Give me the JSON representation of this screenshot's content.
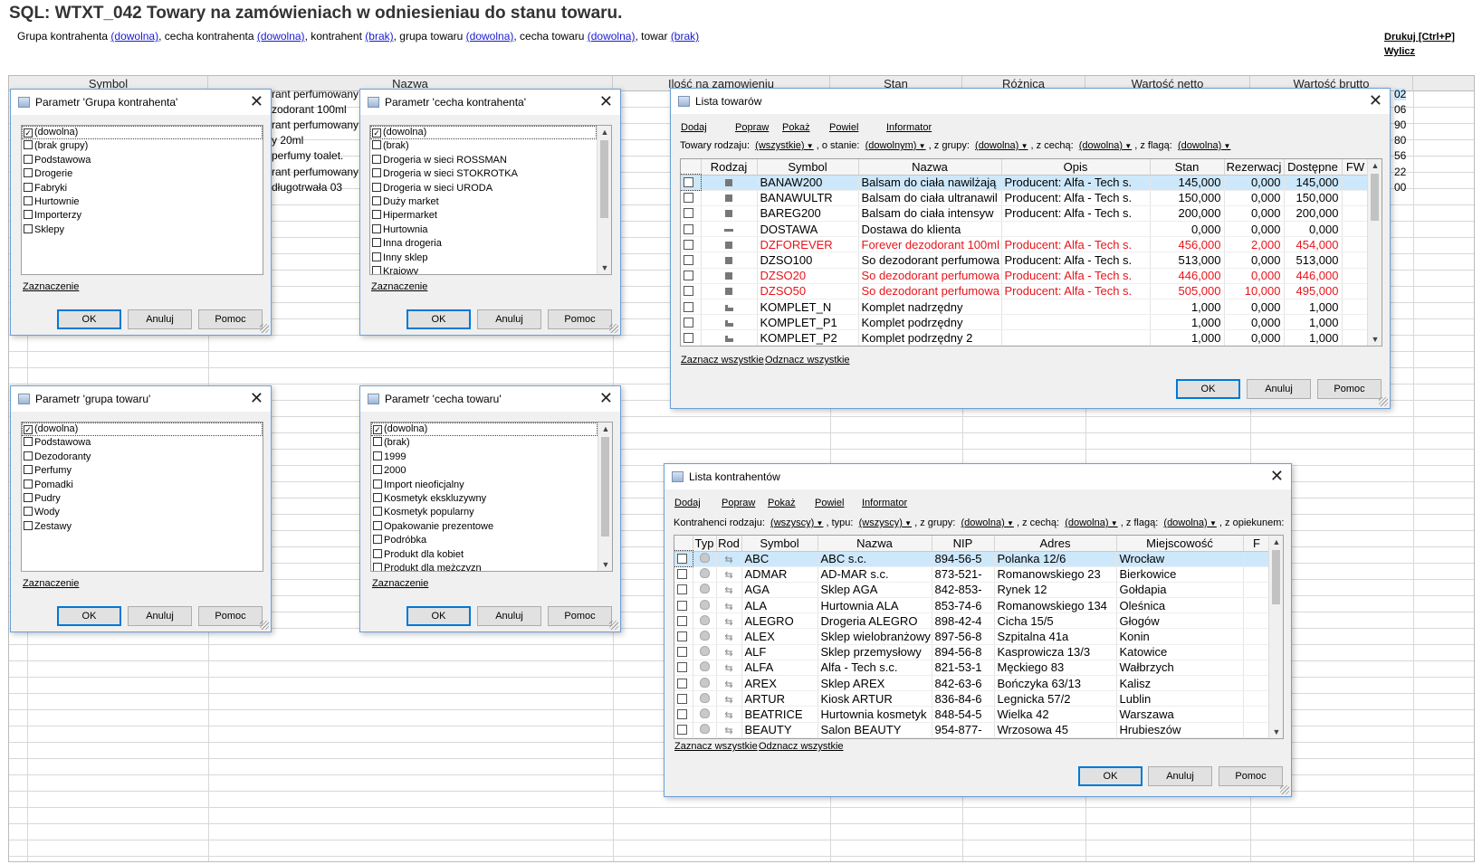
{
  "report": {
    "title": "SQL: WTXT_042 Towary na zamówieniach w odniesieniau do stanu towaru.",
    "params_text": [
      "Grupa kontrahenta ",
      ", cecha kontrahenta ",
      ", kontrahent ",
      ", grupa towaru ",
      ", cecha towaru ",
      ", towar "
    ],
    "param_links": [
      "(dowolna)",
      "(dowolna)",
      "(brak)",
      "(dowolna)",
      "(dowolna)",
      "(brak)"
    ],
    "print_label": "Drukuj [Ctrl+P]",
    "calc_label": "Wylicz",
    "columns": [
      "Symbol",
      "Nazwa",
      "Ilość na zamowieniu",
      "Stan",
      "Różnica",
      "Wartość netto",
      "Wartość brutto"
    ],
    "visible_names": [
      "rant perfumowany",
      "zodorant 100ml",
      "rant perfumowany",
      "y 20ml",
      "perfumy toalet.",
      "rant perfumowany",
      "długotrwała 03"
    ],
    "visible_right_values": [
      "02",
      "06",
      "90",
      "80",
      "56",
      "22",
      "00"
    ]
  },
  "dialog_grupa_kontrahenta": {
    "title": "Parametr 'Grupa kontrahenta'",
    "items": [
      {
        "label": "(dowolna)",
        "checked": true
      },
      {
        "label": "(brak grupy)",
        "checked": false
      },
      {
        "label": "Podstawowa",
        "checked": false
      },
      {
        "label": "Drogerie",
        "checked": false
      },
      {
        "label": "Fabryki",
        "checked": false
      },
      {
        "label": "Hurtownie",
        "checked": false
      },
      {
        "label": "Importerzy",
        "checked": false
      },
      {
        "label": "Sklepy",
        "checked": false
      }
    ],
    "zaznaczenie": "Zaznaczenie",
    "ok": "OK",
    "cancel": "Anuluj",
    "help": "Pomoc"
  },
  "dialog_cecha_kontrahenta": {
    "title": "Parametr 'cecha kontrahenta'",
    "items": [
      {
        "label": "(dowolna)",
        "checked": true
      },
      {
        "label": "(brak)",
        "checked": false
      },
      {
        "label": "Drogeria w sieci ROSSMAN",
        "checked": false
      },
      {
        "label": "Drogeria w sieci STOKROTKA",
        "checked": false
      },
      {
        "label": "Drogeria w sieci URODA",
        "checked": false
      },
      {
        "label": "Duży market",
        "checked": false
      },
      {
        "label": "Hipermarket",
        "checked": false
      },
      {
        "label": "Hurtownia",
        "checked": false
      },
      {
        "label": "Inna drogeria",
        "checked": false
      },
      {
        "label": "Inny sklep",
        "checked": false
      },
      {
        "label": "Krajowy",
        "checked": false
      }
    ],
    "zaznaczenie": "Zaznaczenie",
    "ok": "OK",
    "cancel": "Anuluj",
    "help": "Pomoc"
  },
  "dialog_grupa_towaru": {
    "title": "Parametr 'grupa towaru'",
    "items": [
      {
        "label": "(dowolna)",
        "checked": true
      },
      {
        "label": "Podstawowa",
        "checked": false
      },
      {
        "label": "Dezodoranty",
        "checked": false
      },
      {
        "label": "Perfumy",
        "checked": false
      },
      {
        "label": "Pomadki",
        "checked": false
      },
      {
        "label": "Pudry",
        "checked": false
      },
      {
        "label": "Wody",
        "checked": false
      },
      {
        "label": "Zestawy",
        "checked": false
      }
    ],
    "zaznaczenie": "Zaznaczenie",
    "ok": "OK",
    "cancel": "Anuluj",
    "help": "Pomoc"
  },
  "dialog_cecha_towaru": {
    "title": "Parametr 'cecha towaru'",
    "items": [
      {
        "label": "(dowolna)",
        "checked": true
      },
      {
        "label": "(brak)",
        "checked": false
      },
      {
        "label": "1999",
        "checked": false
      },
      {
        "label": "2000",
        "checked": false
      },
      {
        "label": "Import nieoficjalny",
        "checked": false
      },
      {
        "label": "Kosmetyk ekskluzywny",
        "checked": false
      },
      {
        "label": "Kosmetyk popularny",
        "checked": false
      },
      {
        "label": "Opakowanie prezentowe",
        "checked": false
      },
      {
        "label": "Podróbka",
        "checked": false
      },
      {
        "label": "Produkt dla kobiet",
        "checked": false
      },
      {
        "label": "Produkt dla mężczyzn",
        "checked": false
      }
    ],
    "zaznaczenie": "Zaznaczenie",
    "ok": "OK",
    "cancel": "Anuluj",
    "help": "Pomoc"
  },
  "lista_towarow": {
    "title": "Lista towarów",
    "menu": [
      "Dodaj",
      "Popraw",
      "Pokaż",
      "Powiel",
      "Informator"
    ],
    "filters": {
      "rodzaj_label": "Towary rodzaju:",
      "rodzaj_value": "(wszystkie)",
      "stan_label": ", o stanie:",
      "stan_value": "(dowolnym)",
      "grupy_label": ", z grupy:",
      "grupy_value": "(dowolna)",
      "cecha_label": ", z cechą:",
      "cecha_value": "(dowolna)",
      "flaga_label": ", z flagą:",
      "flaga_value": "(dowolna)"
    },
    "columns": [
      "Rodzaj",
      "Symbol",
      "Nazwa",
      "Opis",
      "Stan",
      "Rezerwacj",
      "Dostępne",
      "FW"
    ],
    "rows": [
      {
        "kind": "towar",
        "symbol": "BANAW200",
        "name": "Balsam do ciała nawilżają",
        "desc": "Producent:  Alfa - Tech s.",
        "stan": "145,000",
        "rez": "0,000",
        "dost": "145,000",
        "red": false
      },
      {
        "kind": "towar",
        "symbol": "BANAWULTR",
        "name": "Balsam do ciała ultranawil",
        "desc": "Producent:  Alfa - Tech s.",
        "stan": "150,000",
        "rez": "0,000",
        "dost": "150,000",
        "red": false
      },
      {
        "kind": "towar",
        "symbol": "BAREG200",
        "name": "Balsam do ciała intensyw",
        "desc": "Producent:  Alfa - Tech s.",
        "stan": "200,000",
        "rez": "0,000",
        "dost": "200,000",
        "red": false
      },
      {
        "kind": "usluga",
        "symbol": "DOSTAWA",
        "name": "Dostawa do klienta",
        "desc": "",
        "stan": "0,000",
        "rez": "0,000",
        "dost": "0,000",
        "red": false
      },
      {
        "kind": "towar",
        "symbol": "DZFOREVER",
        "name": "Forever dezodorant 100ml",
        "desc": "Producent:  Alfa - Tech s.",
        "stan": "456,000",
        "rez": "2,000",
        "dost": "454,000",
        "red": true
      },
      {
        "kind": "towar",
        "symbol": "DZSO100",
        "name": "So dezodorant perfumowa",
        "desc": "Producent:  Alfa - Tech s.",
        "stan": "513,000",
        "rez": "0,000",
        "dost": "513,000",
        "red": false
      },
      {
        "kind": "towar",
        "symbol": "DZSO20",
        "name": "So dezodorant perfumowa",
        "desc": "Producent:  Alfa - Tech s.",
        "stan": "446,000",
        "rez": "0,000",
        "dost": "446,000",
        "red": true
      },
      {
        "kind": "towar",
        "symbol": "DZSO50",
        "name": "So dezodorant perfumowa",
        "desc": "Producent:  Alfa - Tech s.",
        "stan": "505,000",
        "rez": "10,000",
        "dost": "495,000",
        "red": true
      },
      {
        "kind": "komplet",
        "symbol": "KOMPLET_N",
        "name": "Komplet nadrzędny",
        "desc": "",
        "stan": "1,000",
        "rez": "0,000",
        "dost": "1,000",
        "red": false
      },
      {
        "kind": "komplet",
        "symbol": "KOMPLET_P1",
        "name": "Komplet podrzędny",
        "desc": "",
        "stan": "1,000",
        "rez": "0,000",
        "dost": "1,000",
        "red": false
      },
      {
        "kind": "komplet",
        "symbol": "KOMPLET_P2",
        "name": "Komplet podrzędny 2",
        "desc": "",
        "stan": "1,000",
        "rez": "0,000",
        "dost": "1,000",
        "red": false
      }
    ],
    "select_all": "Zaznacz wszystkie",
    "deselect_all": "Odznacz wszystkie",
    "ok": "OK",
    "cancel": "Anuluj",
    "help": "Pomoc"
  },
  "lista_kontrahentow": {
    "title": "Lista kontrahentów",
    "menu": [
      "Dodaj",
      "Popraw",
      "Pokaż",
      "Powiel",
      "Informator"
    ],
    "filters": {
      "rodzaj_label": "Kontrahenci rodzaju:",
      "rodzaj_value": "(wszyscy)",
      "typ_label": ", typu:",
      "typ_value": "(wszyscy)",
      "grupy_label": ", z grupy:",
      "grupy_value": "(dowolna)",
      "cecha_label": ", z cechą:",
      "cecha_value": "(dowolna)",
      "flaga_label": ", z flagą:",
      "flaga_value": "(dowolna)",
      "opiekun_label": ", z opiekunem:"
    },
    "columns": [
      "Typ",
      "Rod",
      "Symbol",
      "Nazwa",
      "NIP",
      "Adres",
      "Miejscowość",
      "F"
    ],
    "rows": [
      {
        "symbol": "ABC",
        "name": "ABC s.c.",
        "nip": "894-56-5",
        "addr": "Polanka  12/6",
        "city": "Wrocław"
      },
      {
        "symbol": "ADMAR",
        "name": "AD-MAR s.c.",
        "nip": "873-521-",
        "addr": "Romanowskiego 23",
        "city": "Bierkowice"
      },
      {
        "symbol": "AGA",
        "name": "Sklep AGA",
        "nip": "842-853-",
        "addr": "Rynek 12",
        "city": "Gołdapia"
      },
      {
        "symbol": "ALA",
        "name": "Hurtownia ALA",
        "nip": "853-74-6",
        "addr": "Romanowskiego  134",
        "city": "Oleśnica"
      },
      {
        "symbol": "ALEGRO",
        "name": "Drogeria ALEGRO",
        "nip": "898-42-4",
        "addr": "Cicha  15/5",
        "city": "Głogów"
      },
      {
        "symbol": "ALEX",
        "name": "Sklep wielobranżowy",
        "nip": "897-56-8",
        "addr": "Szpitalna  41a",
        "city": "Konin"
      },
      {
        "symbol": "ALF",
        "name": "Sklep przemysłowy",
        "nip": "894-56-8",
        "addr": "Kasprowicza  13/3",
        "city": "Katowice"
      },
      {
        "symbol": "ALFA",
        "name": "Alfa - Tech s.c.",
        "nip": "821-53-1",
        "addr": "Męckiego  83",
        "city": "Wałbrzych"
      },
      {
        "symbol": "AREX",
        "name": "Sklep AREX",
        "nip": "842-63-6",
        "addr": "Bończyka  63/13",
        "city": "Kalisz"
      },
      {
        "symbol": "ARTUR",
        "name": "Kiosk ARTUR",
        "nip": "836-84-6",
        "addr": "Legnicka  57/2",
        "city": "Lublin"
      },
      {
        "symbol": "BEATRICE",
        "name": "Hurtownia kosmetyk",
        "nip": "848-54-5",
        "addr": "Wielka  42",
        "city": "Warszawa"
      },
      {
        "symbol": "BEAUTY",
        "name": "Salon BEAUTY",
        "nip": "954-877-",
        "addr": "Wrzosowa  45",
        "city": "Hrubieszów"
      }
    ],
    "select_all": "Zaznacz wszystkie",
    "deselect_all": "Odznacz wszystkie",
    "ok": "OK",
    "cancel": "Anuluj",
    "help": "Pomoc"
  }
}
